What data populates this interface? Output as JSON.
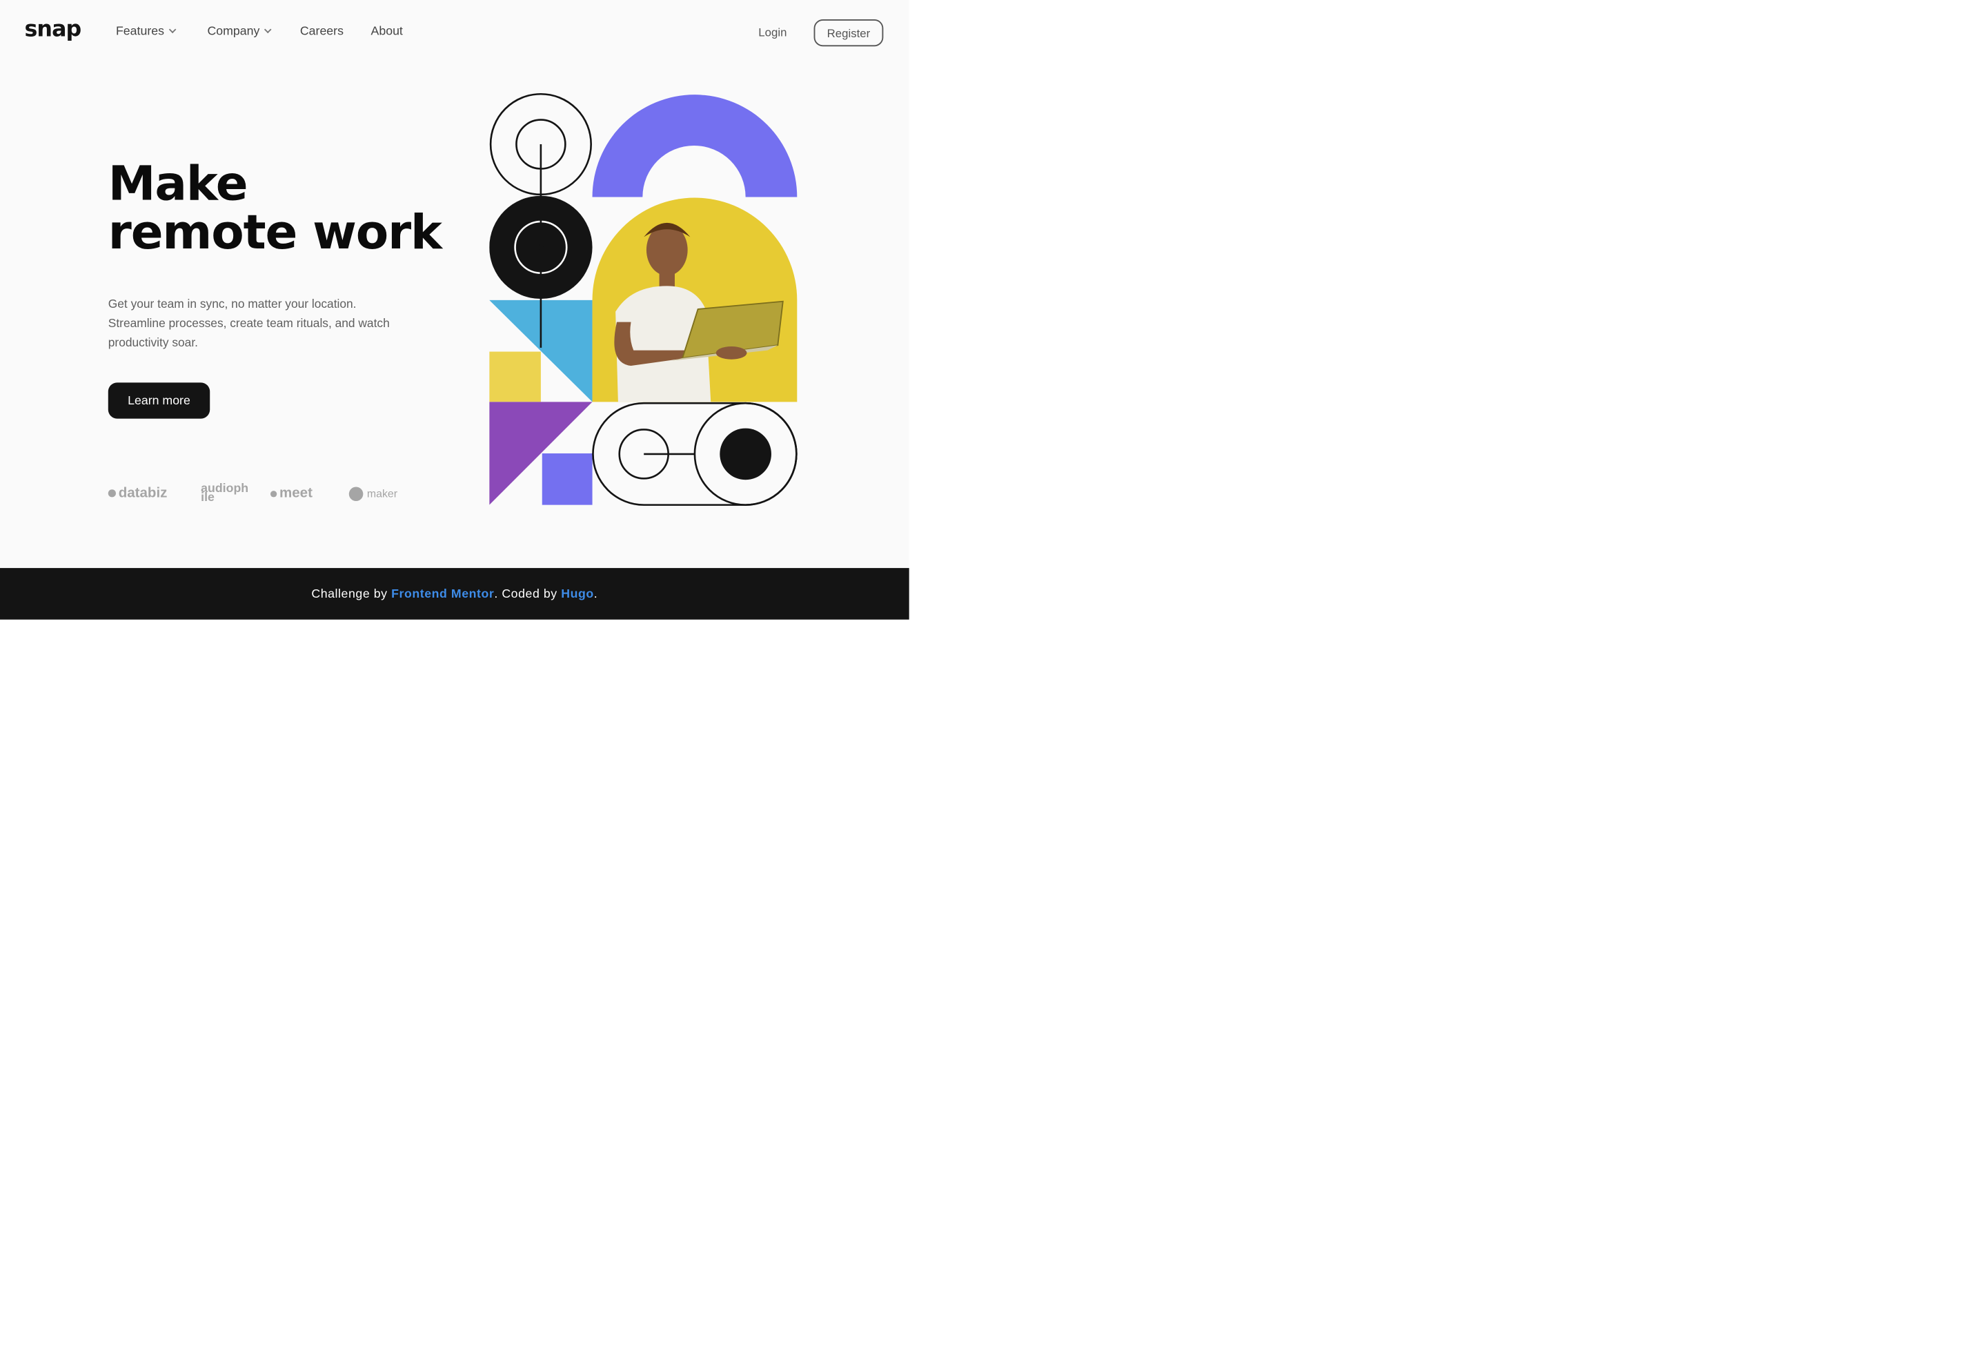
{
  "brand": {
    "logo": "snap"
  },
  "nav": {
    "items": [
      {
        "label": "Features",
        "has_dropdown": true
      },
      {
        "label": "Company",
        "has_dropdown": true
      },
      {
        "label": "Careers",
        "has_dropdown": false
      },
      {
        "label": "About",
        "has_dropdown": false
      }
    ],
    "login": "Login",
    "register": "Register"
  },
  "hero": {
    "title_line1": "Make",
    "title_line2": "remote work",
    "description": "Get your team in sync, no matter your location. Streamline processes, create team rituals, and watch productivity soar.",
    "cta": "Learn more"
  },
  "clients": [
    {
      "name": "databiz"
    },
    {
      "name": "audiophile"
    },
    {
      "name": "meet"
    },
    {
      "name": "maker"
    }
  ],
  "footer": {
    "prefix": "Challenge by",
    "link1": "Frontend Mentor",
    "middle": ". Coded by",
    "link2": "Hugo",
    "suffix": "."
  },
  "colors": {
    "accent_purple": "#7470f0",
    "accent_yellow": "#e7cb33",
    "accent_blue": "#4eb1dd",
    "accent_violet": "#8b49b8",
    "dark": "#141414",
    "link": "#3e8ce8"
  }
}
